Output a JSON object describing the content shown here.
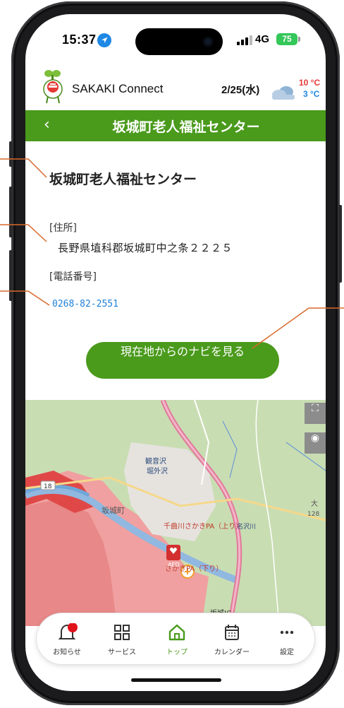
{
  "status_bar": {
    "time": "15:37",
    "network": "4G",
    "battery": "75"
  },
  "app": {
    "name": "SAKAKI Connect",
    "date": "2/25(水)",
    "temp_high": "10 °C",
    "temp_low": "3 °C",
    "weather_icon": "cloud-icon"
  },
  "title_bar": {
    "back_icon": "chevron-left-icon",
    "title": "坂城町老人福祉センター"
  },
  "facility": {
    "name": "坂城町老人福祉センター",
    "address_label": "[住所]",
    "address": "長野県埴科郡坂城町中之条２２２５",
    "phone_label": "[電話番号]",
    "phone": "0268-82-2551"
  },
  "navi_button": "現在地からのナビを見る",
  "map": {
    "labels": [
      "観音沢",
      "堀外沢",
      "坂城町",
      "千曲川さかきPA（上り）",
      "さかきPA（下り）",
      "AED",
      "坂城IC",
      "坂城IC",
      "大",
      "128",
      "名沢川"
    ],
    "road_number": "18",
    "fullscreen_icon": "fullscreen-icon",
    "locate_icon": "locate-icon"
  },
  "tabs": [
    {
      "label": "お知らせ",
      "icon": "bell-icon"
    },
    {
      "label": "サービス",
      "icon": "grid-icon"
    },
    {
      "label": "トップ",
      "icon": "home-icon",
      "active": true
    },
    {
      "label": "カレンダー",
      "icon": "calendar-icon"
    },
    {
      "label": "設定",
      "icon": "more-icon"
    }
  ],
  "colors": {
    "accent": "#4a9a1c",
    "link": "#1e7fd8",
    "callout": "#d9692a"
  }
}
